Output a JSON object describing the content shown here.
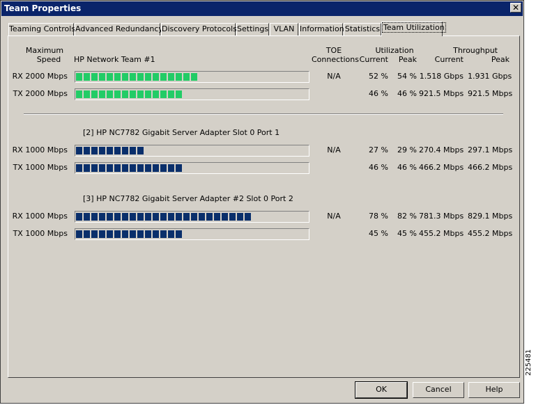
{
  "window": {
    "title": "Team Properties",
    "close_glyph": "✕"
  },
  "tabs": [
    {
      "label": "Teaming Controls",
      "active": false
    },
    {
      "label": "Advanced Redundancy",
      "active": false
    },
    {
      "label": "Discovery Protocols",
      "active": false
    },
    {
      "label": "Settings",
      "active": false
    },
    {
      "label": "VLAN",
      "active": false
    },
    {
      "label": "Information",
      "active": false
    },
    {
      "label": "Statistics",
      "active": false
    },
    {
      "label": "Team Utilization",
      "active": true
    }
  ],
  "headers": {
    "max_speed_1": "Maximum",
    "max_speed_2": "Speed",
    "toe_1": "TOE",
    "toe_2": "Connections",
    "utilization": "Utilization",
    "util_current": "Current",
    "util_peak": "Peak",
    "throughput": "Throughput",
    "thr_current": "Current",
    "thr_peak": "Peak"
  },
  "colors": {
    "team_bar": "#22cc66",
    "adapter_bar": "#0a2f6b"
  },
  "groups": [
    {
      "name": "HP Network Team #1",
      "rows": [
        {
          "speed": "RX 2000 Mbps",
          "toe": "N/A",
          "util_current": "52 %",
          "util_peak": "54 %",
          "thr_current": "1.518 Gbps",
          "thr_peak": "1.931 Gbps",
          "fill": 0.52
        },
        {
          "speed": "TX 2000 Mbps",
          "toe": "",
          "util_current": "46 %",
          "util_peak": "46 %",
          "thr_current": "921.5 Mbps",
          "thr_peak": "921.5 Mbps",
          "fill": 0.46
        }
      ]
    },
    {
      "name": "[2] HP NC7782 Gigabit Server Adapter Slot 0 Port 1",
      "rows": [
        {
          "speed": "RX 1000 Mbps",
          "toe": "N/A",
          "util_current": "27 %",
          "util_peak": "29 %",
          "thr_current": "270.4 Mbps",
          "thr_peak": "297.1 Mbps",
          "fill": 0.29
        },
        {
          "speed": "TX 1000 Mbps",
          "toe": "",
          "util_current": "46 %",
          "util_peak": "46 %",
          "thr_current": "466.2 Mbps",
          "thr_peak": "466.2 Mbps",
          "fill": 0.46
        }
      ]
    },
    {
      "name": "[3] HP NC7782 Gigabit Server Adapter #2 Slot 0 Port 2",
      "rows": [
        {
          "speed": "RX 1000 Mbps",
          "toe": "N/A",
          "util_current": "78 %",
          "util_peak": "82 %",
          "thr_current": "781.3 Mbps",
          "thr_peak": "829.1 Mbps",
          "fill": 0.78
        },
        {
          "speed": "TX 1000 Mbps",
          "toe": "",
          "util_current": "45 %",
          "util_peak": "45 %",
          "thr_current": "455.2 Mbps",
          "thr_peak": "455.2 Mbps",
          "fill": 0.45
        }
      ]
    }
  ],
  "buttons": {
    "ok": "OK",
    "cancel": "Cancel",
    "help": "Help"
  },
  "figure_id": "225481"
}
